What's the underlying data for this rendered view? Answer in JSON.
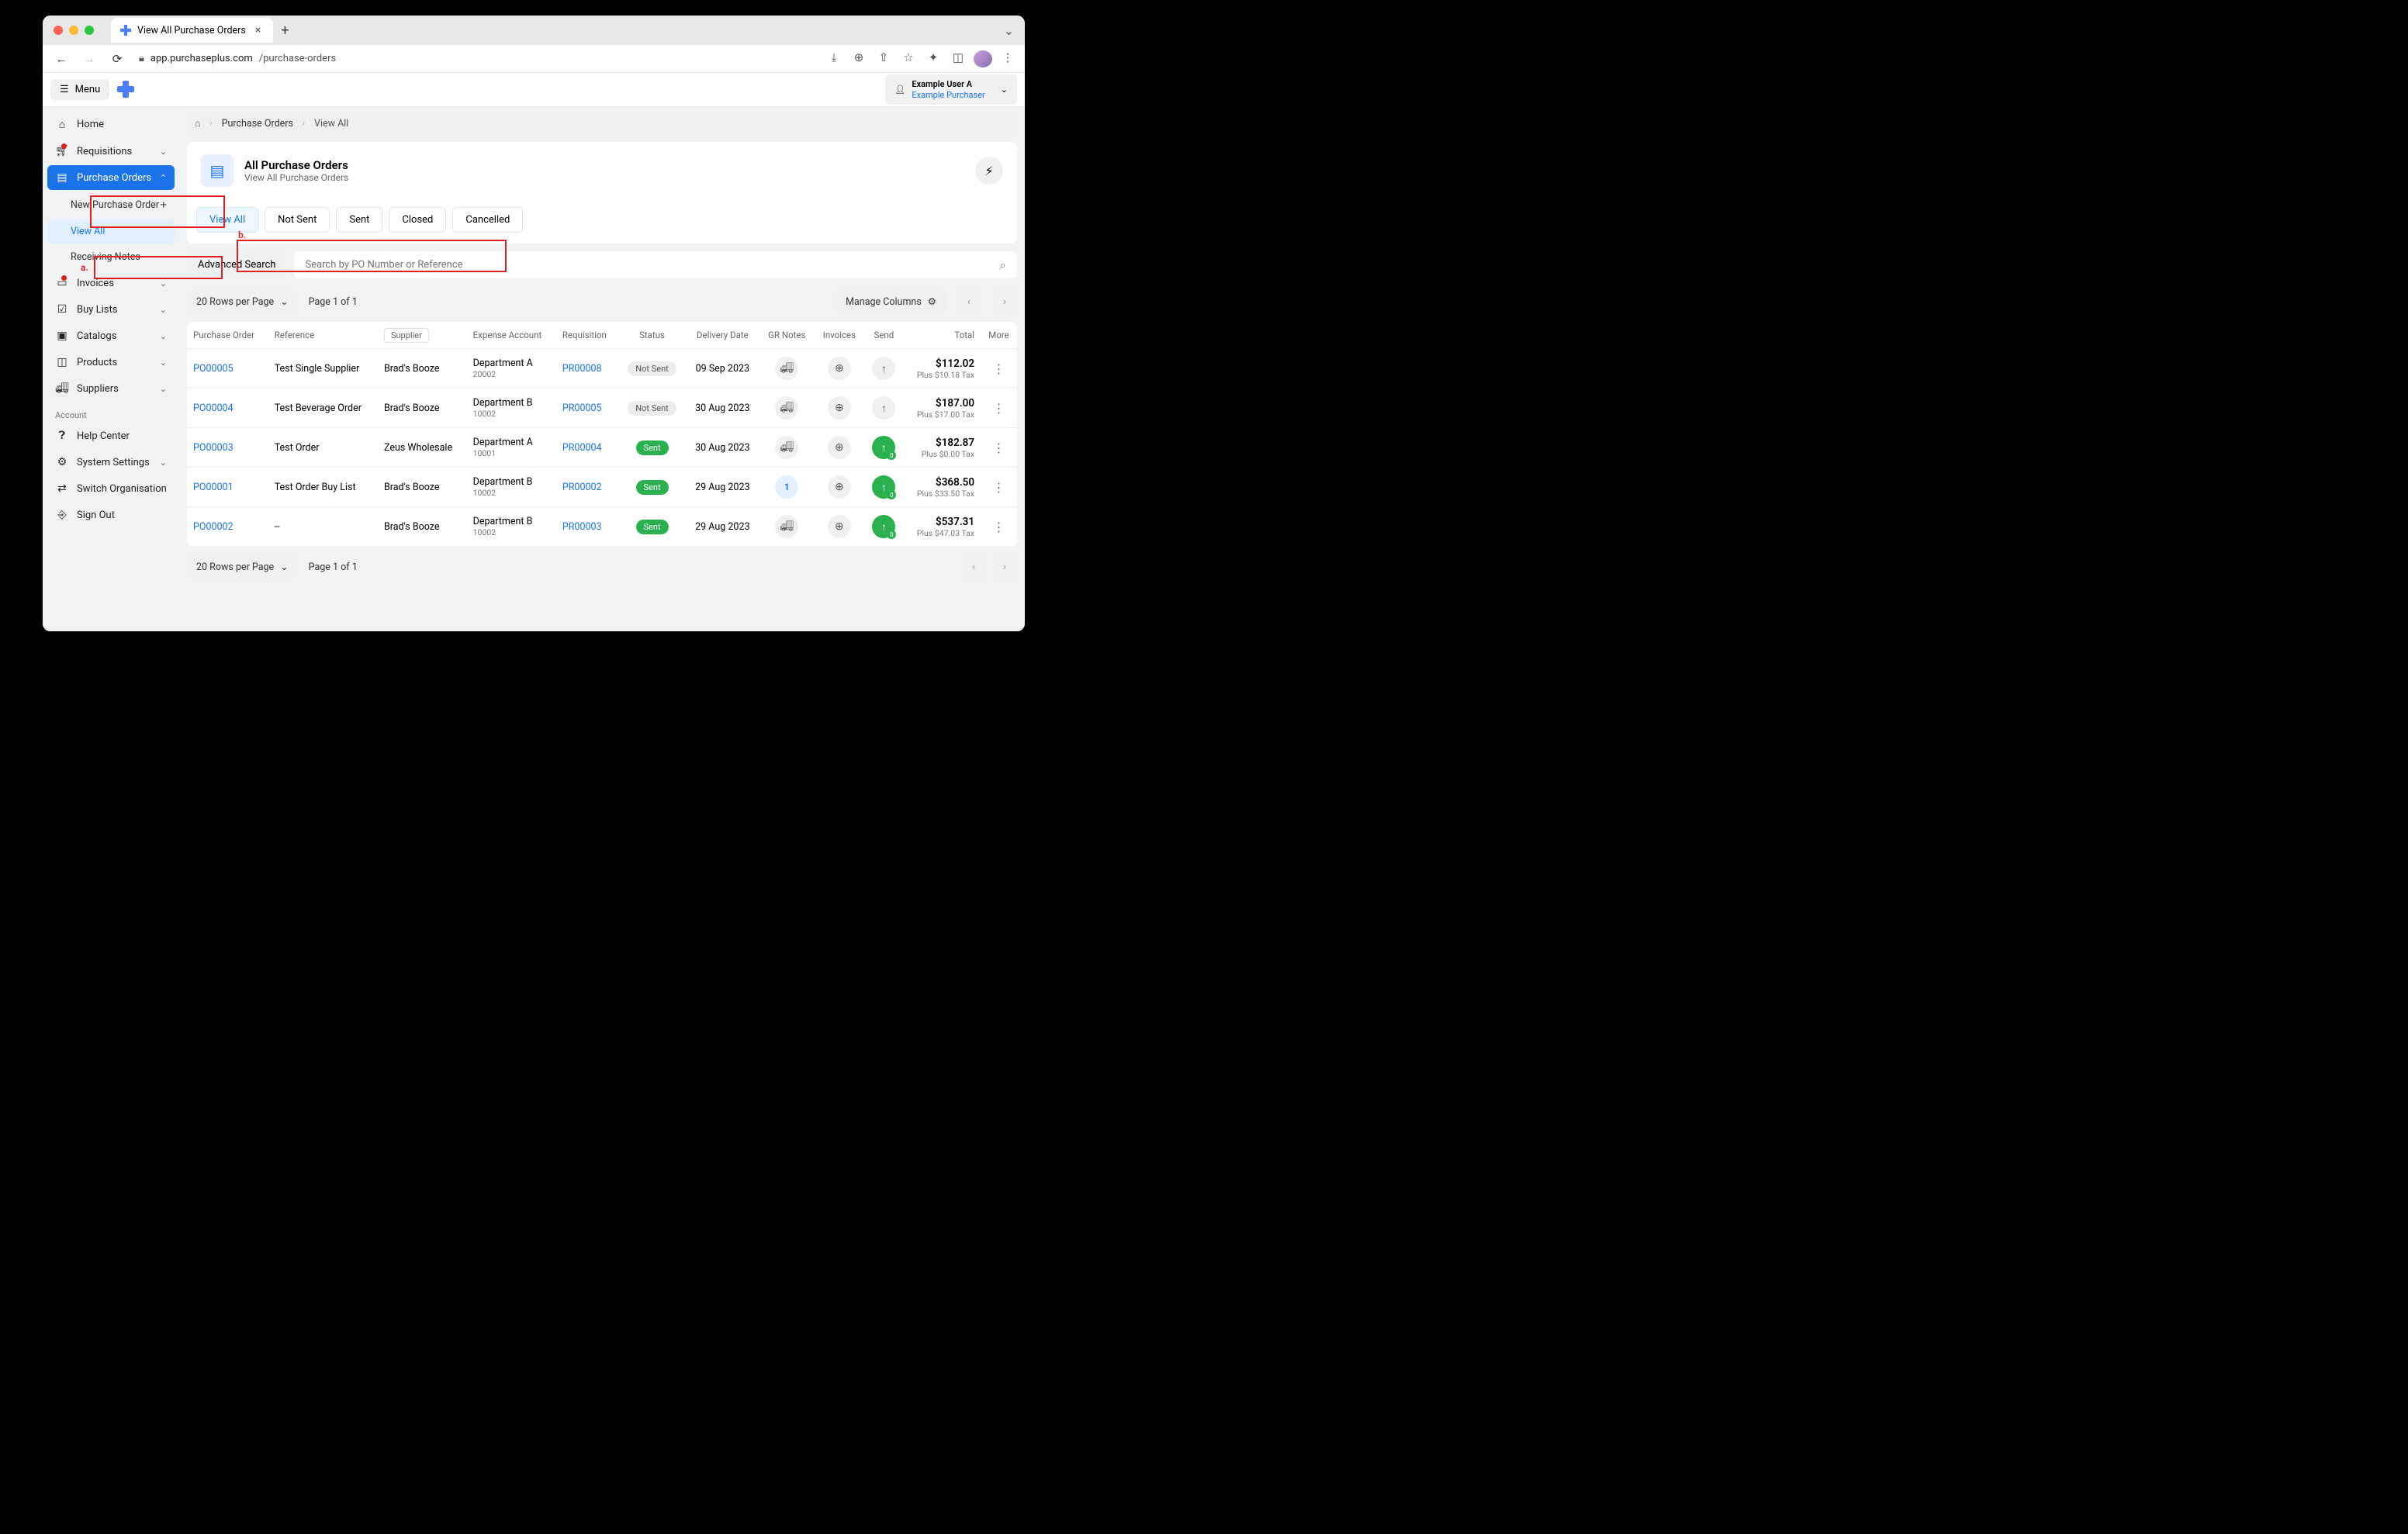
{
  "browser": {
    "tab_title": "View All Purchase Orders",
    "url_host": "app.purchaseplus.com",
    "url_path": "/purchase-orders"
  },
  "topbar": {
    "menu": "Menu",
    "user_name": "Example User A",
    "user_org": "Example Purchaser"
  },
  "sidebar": {
    "home": "Home",
    "requisitions": "Requisitions",
    "purchase_orders": "Purchase Orders",
    "new_po": "New Purchase Order",
    "view_all": "View All",
    "receiving": "Receiving Notes",
    "invoices": "Invoices",
    "buy_lists": "Buy Lists",
    "catalogs": "Catalogs",
    "products": "Products",
    "suppliers": "Suppliers",
    "account_label": "Account",
    "help": "Help Center",
    "settings": "System Settings",
    "switch": "Switch Organisation",
    "signout": "Sign Out"
  },
  "breadcrumb": {
    "l1": "Purchase Orders",
    "l2": "View All"
  },
  "header": {
    "title": "All Purchase Orders",
    "subtitle": "View All Purchase Orders"
  },
  "tabs": [
    "View All",
    "Not Sent",
    "Sent",
    "Closed",
    "Cancelled"
  ],
  "search": {
    "advanced": "Advanced Search",
    "placeholder": "Search by PO Number or Reference"
  },
  "controls": {
    "rows_per": "20 Rows per Page",
    "page_of": "Page 1 of 1",
    "manage": "Manage Columns"
  },
  "columns": {
    "po": "Purchase Order",
    "ref": "Reference",
    "sup": "Supplier",
    "exp": "Expense Account",
    "req": "Requisition",
    "status": "Status",
    "deliv": "Delivery Date",
    "gr": "GR Notes",
    "inv": "Invoices",
    "send": "Send",
    "total": "Total",
    "more": "More"
  },
  "rows": [
    {
      "po": "PO00005",
      "ref": "Test Single Supplier",
      "sup": "Brad's Booze",
      "dept": "Department A",
      "code": "20002",
      "req": "PR00008",
      "status": "Not Sent",
      "date": "09 Sep 2023",
      "gr": "truck",
      "send": "grey",
      "total": "$112.02",
      "tax": "Plus $10.18 Tax"
    },
    {
      "po": "PO00004",
      "ref": "Test Beverage Order",
      "sup": "Brad's Booze",
      "dept": "Department B",
      "code": "10002",
      "req": "PR00005",
      "status": "Not Sent",
      "date": "30 Aug 2023",
      "gr": "truck",
      "send": "grey",
      "total": "$187.00",
      "tax": "Plus $17.00 Tax"
    },
    {
      "po": "PO00003",
      "ref": "Test Order",
      "sup": "Zeus Wholesale",
      "dept": "Department A",
      "code": "10001",
      "req": "PR00004",
      "status": "Sent",
      "date": "30 Aug 2023",
      "gr": "truck",
      "send": "green",
      "total": "$182.87",
      "tax": "Plus $0.00 Tax"
    },
    {
      "po": "PO00001",
      "ref": "Test Order Buy List",
      "sup": "Brad's Booze",
      "dept": "Department B",
      "code": "10002",
      "req": "PR00002",
      "status": "Sent",
      "date": "29 Aug 2023",
      "gr": "1",
      "send": "green",
      "total": "$368.50",
      "tax": "Plus $33.50 Tax"
    },
    {
      "po": "PO00002",
      "ref": "--",
      "sup": "Brad's Booze",
      "dept": "Department B",
      "code": "10002",
      "req": "PR00003",
      "status": "Sent",
      "date": "29 Aug 2023",
      "gr": "truck",
      "send": "green",
      "total": "$537.31",
      "tax": "Plus $47.03 Tax"
    }
  ],
  "annotations": {
    "a": "a.",
    "b": "b."
  }
}
